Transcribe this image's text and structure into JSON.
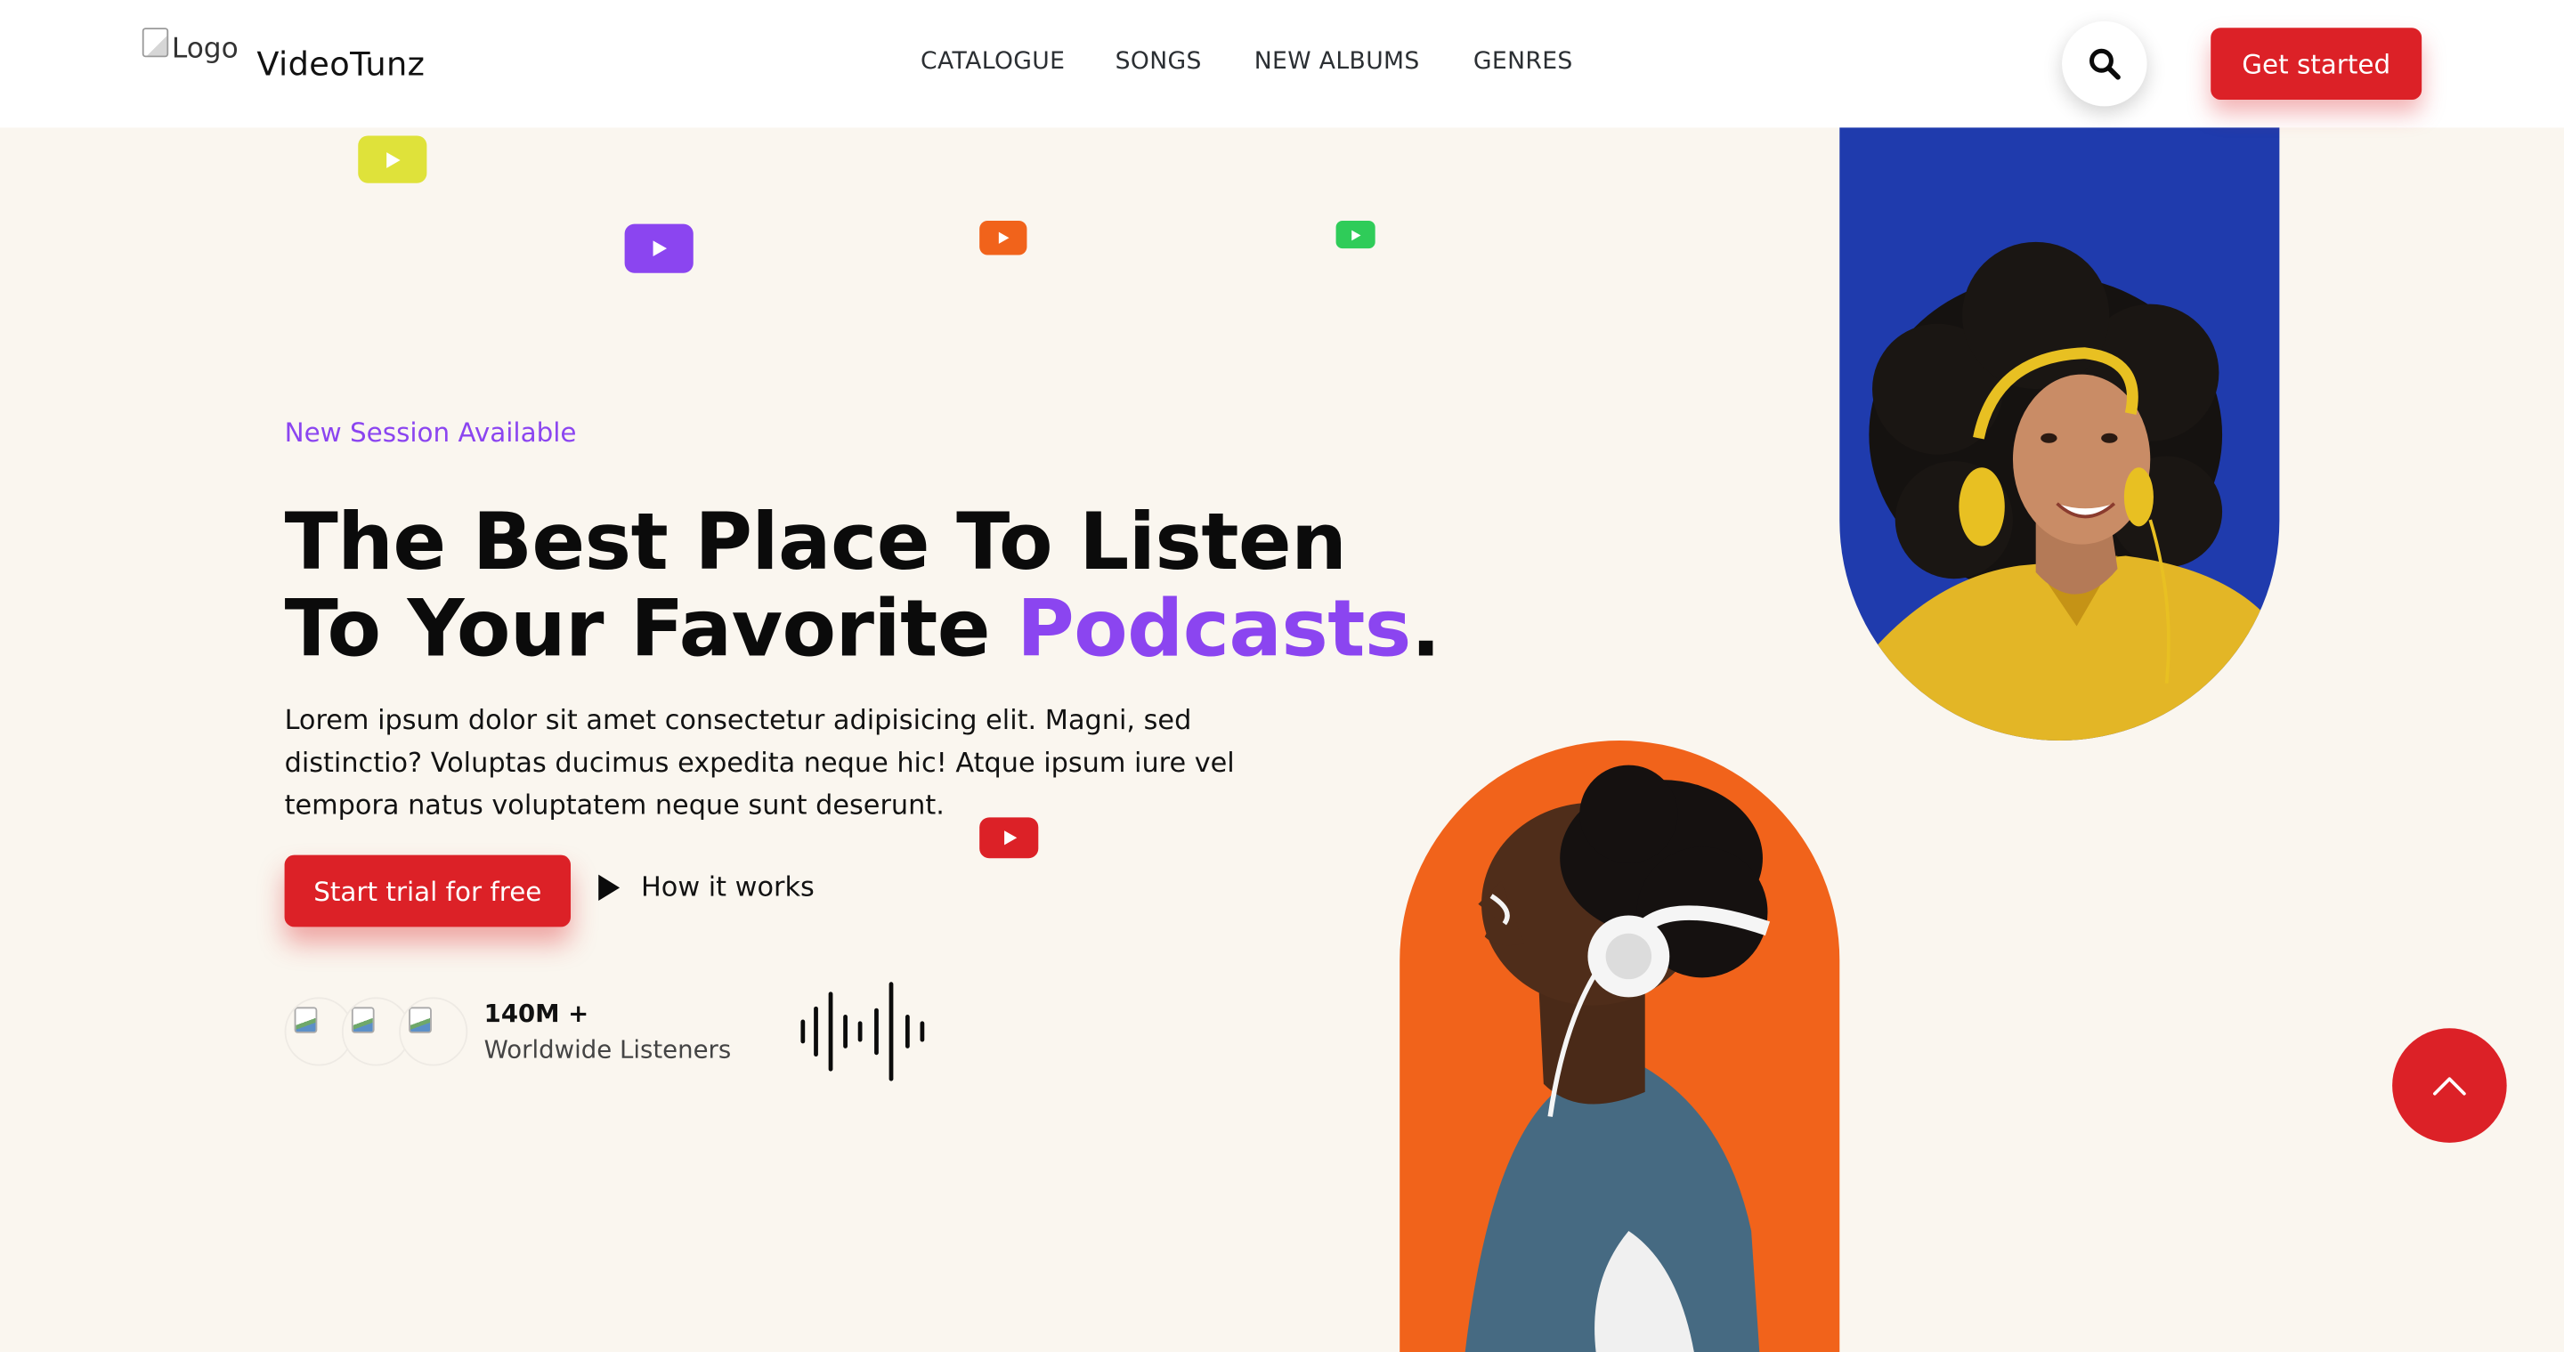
{
  "header": {
    "logo_alt": "Logo",
    "brand": "VideoTunz",
    "nav": [
      "CATALOGUE",
      "SONGS",
      "NEW ALBUMS",
      "GENRES"
    ],
    "search_icon": "search-icon",
    "cta_label": "Get started"
  },
  "hero": {
    "eyebrow": "New Session Available",
    "headline_line1": "The Best Place To Listen",
    "headline_line2_prefix": "To Your Favorite ",
    "headline_accent": "Podcasts",
    "headline_suffix": ".",
    "description": "Lorem ipsum dolor sit amet consectetur adipisicing elit. Magni, sed distinctio? Voluptas ducimus expedita neque hic! Atque ipsum iure vel tempora natus voluptatem neque sunt deserunt.",
    "primary_button": "Start trial for free",
    "secondary_link": "How it works",
    "stat_value": "140M +",
    "stat_label": "Worldwide Listeners"
  },
  "floating_icons": [
    {
      "name": "play-icon",
      "color": "#dfe23a"
    },
    {
      "name": "play-icon",
      "color": "#8b45f0"
    },
    {
      "name": "play-icon",
      "color": "#f1631b"
    },
    {
      "name": "play-icon",
      "color": "#2fcc59"
    },
    {
      "name": "play-icon",
      "color": "#dc2127"
    }
  ],
  "colors": {
    "accent_purple": "#8b45f0",
    "brand_red": "#dc2127",
    "hero_bg": "#faf6ef",
    "photo_blue_bg": "#1f3bad",
    "photo_orange_bg": "#f1631b"
  },
  "images": {
    "top_right": "woman-yellow-headphones",
    "bottom_center": "man-white-headphones"
  },
  "scroll_top_icon": "chevron-up-icon"
}
